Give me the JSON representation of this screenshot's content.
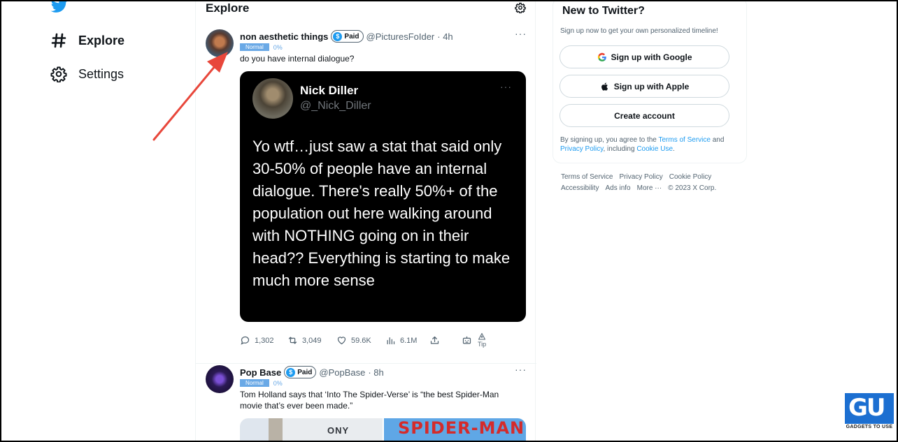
{
  "nav": {
    "items": [
      {
        "label": "Explore",
        "icon": "hashtag-icon"
      },
      {
        "label": "Settings",
        "icon": "gear-icon"
      }
    ]
  },
  "main": {
    "header": "Explore",
    "tweets": [
      {
        "name": "non aesthetic things",
        "paid": "Paid",
        "handle": "@PicturesFoIder",
        "time": "· 4h",
        "badge": "Normal",
        "badge_pct": "0%",
        "text": "do you have internal dialogue?",
        "embed": {
          "name": "Nick Diller",
          "handle": "@_Nick_Diller",
          "body": "Yo wtf…just saw a stat that said only 30-50% of people have an internal dialogue.  There's really 50%+ of the population out here walking around with NOTHING going on in their head?? Everything is starting to make much more sense"
        },
        "actions": {
          "replies": "1,302",
          "retweets": "3,049",
          "likes": "59.6K",
          "views": "6.1M",
          "tip": "Tip"
        }
      },
      {
        "name": "Pop Base",
        "paid": "Paid",
        "handle": "@PopBase",
        "time": "· 8h",
        "badge": "Normal",
        "badge_pct": "0%",
        "text": "Tom Holland says that ‘Into The Spider-Verse’ is “the best Spider-Man movie that’s ever been made.”",
        "media_left_text": "ONY",
        "media_right_text": "SPIDER-MAN"
      }
    ]
  },
  "sidebar": {
    "title": "New to Twitter?",
    "subtitle": "Sign up now to get your own personalized timeline!",
    "google_label": "Sign up with Google",
    "apple_label": "Sign up with Apple",
    "create_label": "Create account",
    "legal_prefix": "By signing up, you agree to the ",
    "terms": "Terms of Service",
    "legal_and": " and ",
    "privacy": "Privacy Policy",
    "legal_including": ", including ",
    "cookie": "Cookie Use",
    "legal_end": ".",
    "footer_row1": [
      "Terms of Service",
      "Privacy Policy",
      "Cookie Policy"
    ],
    "footer_row2": [
      "Accessibility",
      "Ads info",
      "More ···",
      "© 2023 X Corp."
    ]
  },
  "watermark": {
    "text": "GADGETS TO USE"
  },
  "colors": {
    "accent": "#1d9bf0",
    "arrow": "#e8473b",
    "badge": "#6aa9e6"
  }
}
